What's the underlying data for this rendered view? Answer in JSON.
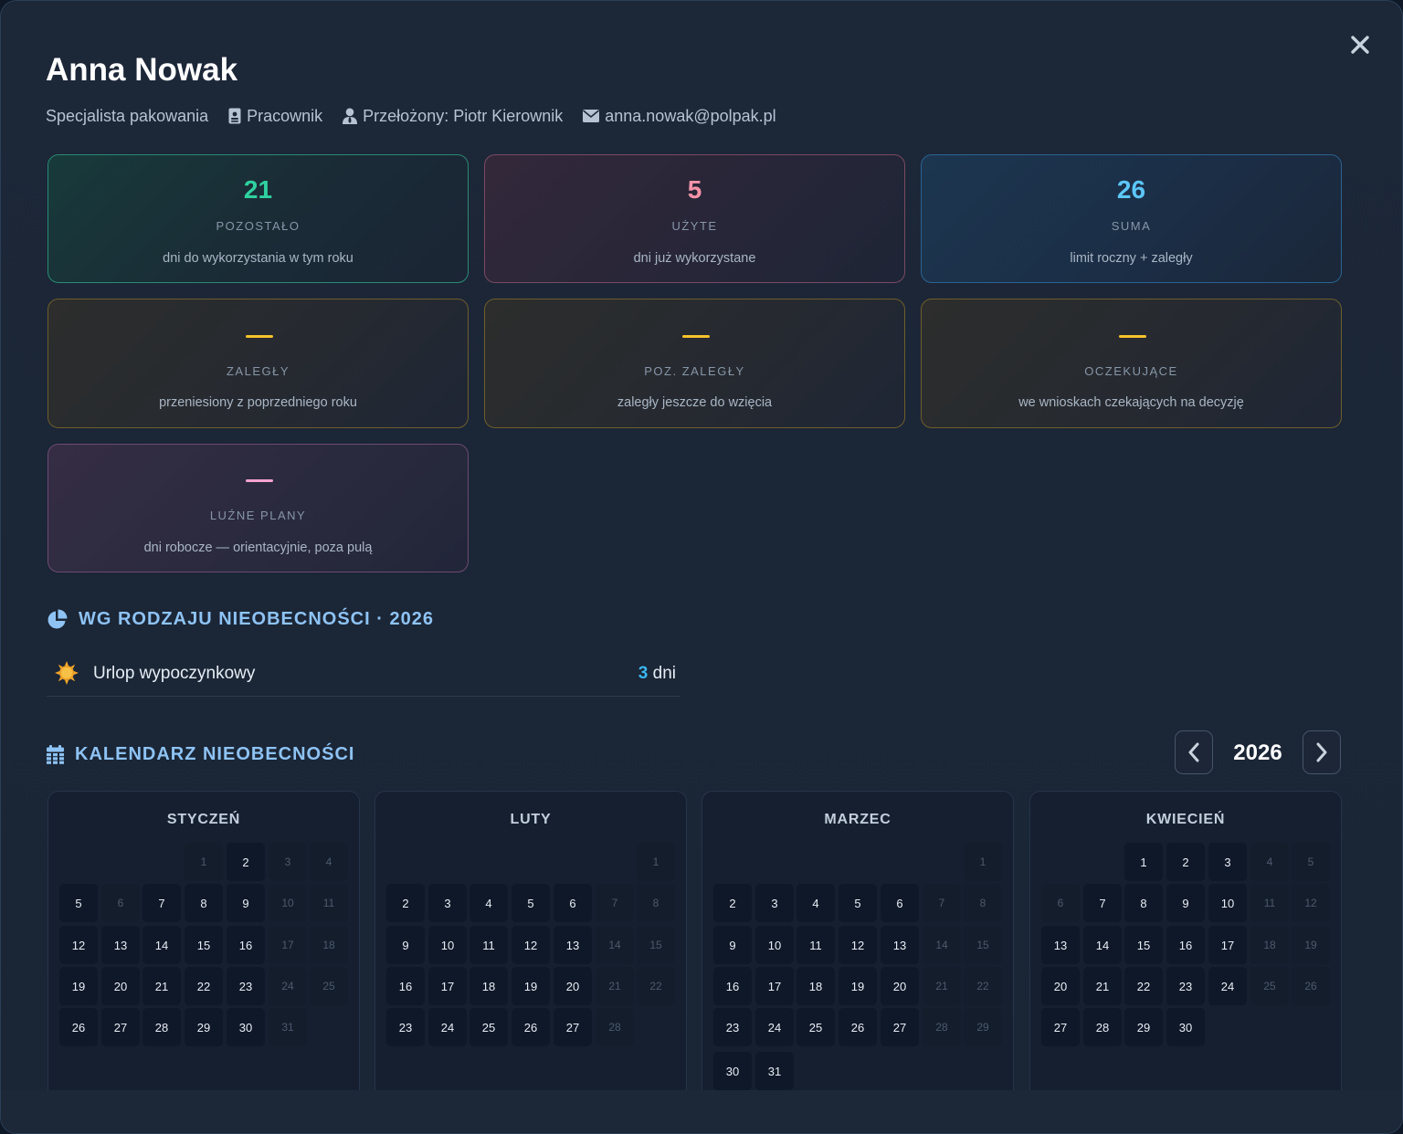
{
  "person": {
    "name": "Anna Nowak",
    "position": "Specjalista pakowania",
    "role": "Pracownik",
    "supervisor": "Przełożony: Piotr Kierownik",
    "email": "anna.nowak@polpak.pl"
  },
  "cards": [
    {
      "value": "21",
      "label": "POZOSTAŁO",
      "desc": "dni do wykorzystania w tym roku",
      "color": "#2fd1a0"
    },
    {
      "value": "5",
      "label": "UŻYTE",
      "desc": "dni już wykorzystane",
      "color": "#f593a8"
    },
    {
      "value": "26",
      "label": "SUMA",
      "desc": "limit roczny + zaległy",
      "color": "#5cc6f7"
    },
    {
      "value": "—",
      "label": "ZALEGŁY",
      "desc": "przeniesiony z poprzedniego roku",
      "color": "#f5c32c"
    },
    {
      "value": "—",
      "label": "POZ. ZALEGŁY",
      "desc": "zaległy jeszcze do wzięcia",
      "color": "#f5c32c"
    },
    {
      "value": "—",
      "label": "OCZEKUJĄCE",
      "desc": "we wnioskach czekających na decyzję",
      "color": "#f5c32c"
    },
    {
      "value": "—",
      "label": "LUŹNE PLANY",
      "desc": "dni robocze — orientacyjnie, poza pulą",
      "color": "#f5a3d0"
    }
  ],
  "by_type": {
    "title": "WG RODZAJU NIEOBECNOŚCI · 2026",
    "items": [
      {
        "name": "Urlop wypoczynkowy",
        "icon": "sun-icon",
        "count": "3",
        "unit": "dni"
      }
    ]
  },
  "calendar": {
    "title": "KALENDARZ NIEOBECNOŚCI",
    "year": "2026",
    "months": [
      {
        "name": "STYCZEŃ",
        "offset": 3,
        "days": 31
      },
      {
        "name": "LUTY",
        "offset": 6,
        "days": 28
      },
      {
        "name": "MARZEC",
        "offset": 6,
        "days": 31
      },
      {
        "name": "KWIECIEŃ",
        "offset": 2,
        "days": 30
      }
    ],
    "off_days": {
      "0": [
        1,
        3,
        4,
        6,
        10,
        11,
        17,
        18,
        24,
        25,
        31
      ],
      "1": [
        1,
        7,
        8,
        14,
        15,
        21,
        22,
        28
      ],
      "2": [
        1,
        7,
        8,
        14,
        15,
        21,
        22,
        28,
        29
      ],
      "3": [
        4,
        5,
        6,
        11,
        12,
        18,
        19,
        25,
        26
      ]
    }
  }
}
